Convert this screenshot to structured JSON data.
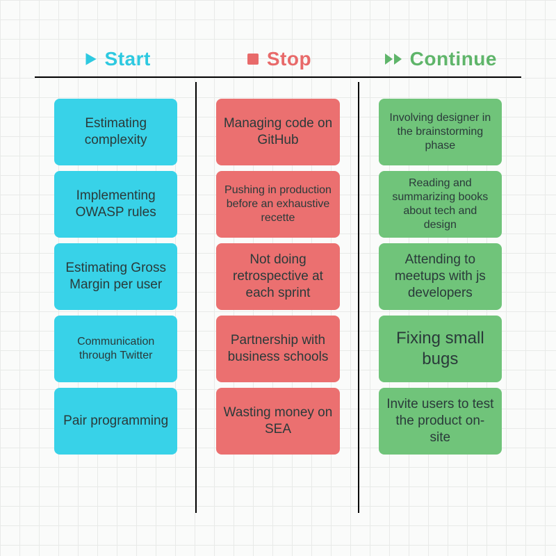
{
  "columns": [
    {
      "id": "start",
      "title": "Start",
      "iconName": "play-icon",
      "color": "#2ec9e0",
      "cards": [
        {
          "text": "Estimating complexity",
          "size": "normal"
        },
        {
          "text": "Implementing OWASP rules",
          "size": "normal"
        },
        {
          "text": "Estimating Gross Margin per user",
          "size": "normal"
        },
        {
          "text": "Communication through Twitter",
          "size": "small"
        },
        {
          "text": "Pair programming",
          "size": "normal"
        }
      ]
    },
    {
      "id": "stop",
      "title": "Stop",
      "iconName": "stop-icon",
      "color": "#e86a6a",
      "cards": [
        {
          "text": "Managing code on GitHub",
          "size": "normal"
        },
        {
          "text": "Pushing in production before an exhaustive recette",
          "size": "small"
        },
        {
          "text": "Not doing retrospective at each sprint",
          "size": "normal"
        },
        {
          "text": "Partnership with business schools",
          "size": "normal"
        },
        {
          "text": "Wasting money on SEA",
          "size": "normal"
        }
      ]
    },
    {
      "id": "continue",
      "title": "Continue",
      "iconName": "fast-forward-icon",
      "color": "#5fb56a",
      "cards": [
        {
          "text": "Involving designer in the brainstorming phase",
          "size": "small"
        },
        {
          "text": "Reading and summarizing books about tech and design",
          "size": "small"
        },
        {
          "text": "Attending to meetups with js developers",
          "size": "normal"
        },
        {
          "text": "Fixing small bugs",
          "size": "big"
        },
        {
          "text": "Invite users to test the product on-site",
          "size": "normal"
        }
      ]
    }
  ]
}
